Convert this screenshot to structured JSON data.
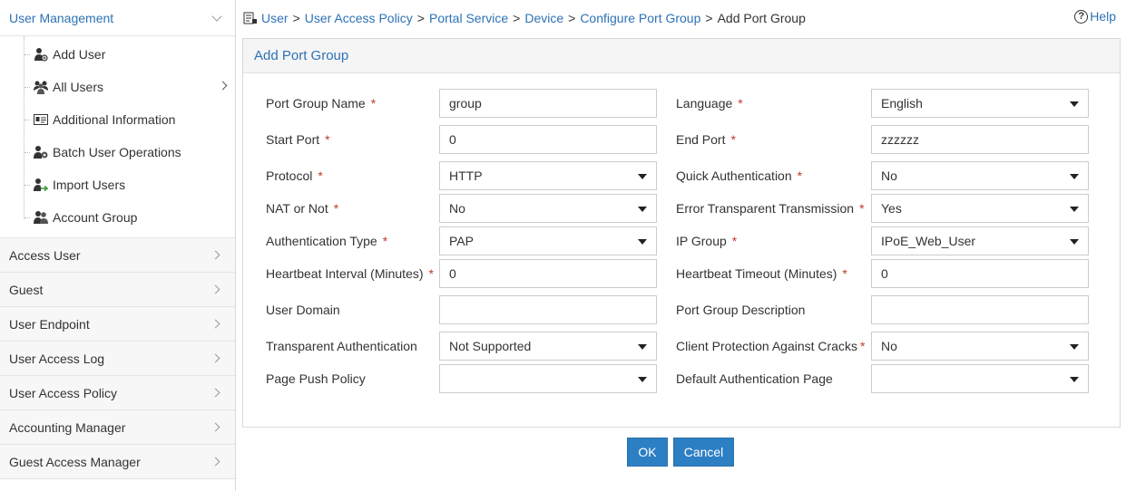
{
  "sidebar": {
    "header": "User Management",
    "sub_items": [
      {
        "label": "Add User",
        "icon": "add-user-icon"
      },
      {
        "label": "All Users",
        "icon": "all-users-icon"
      },
      {
        "label": "Additional Information",
        "icon": "id-card-icon"
      },
      {
        "label": "Batch User Operations",
        "icon": "batch-users-icon"
      },
      {
        "label": "Import Users",
        "icon": "import-users-icon"
      },
      {
        "label": "Account Group",
        "icon": "account-group-icon"
      }
    ],
    "categories": [
      "Access User",
      "Guest",
      "User Endpoint",
      "User Access Log",
      "User Access Policy",
      "Accounting Manager",
      "Guest Access Manager"
    ]
  },
  "breadcrumb": [
    "User",
    "User Access Policy",
    "Portal Service",
    "Device",
    "Configure Port Group",
    "Add Port Group"
  ],
  "breadcrumb_sep": ">",
  "help_label": "Help",
  "panel_title": "Add Port Group",
  "required_mark": "*",
  "form": {
    "port_group_name": {
      "label": "Port Group Name",
      "value": "group"
    },
    "language": {
      "label": "Language",
      "value": "English"
    },
    "start_port": {
      "label": "Start Port",
      "value": "0"
    },
    "end_port": {
      "label": "End Port",
      "value": "zzzzzz"
    },
    "protocol": {
      "label": "Protocol",
      "value": "HTTP"
    },
    "quick_auth": {
      "label": "Quick Authentication",
      "value": "No"
    },
    "nat": {
      "label": "NAT or Not",
      "value": "No"
    },
    "error_transparent": {
      "label": "Error Transparent Transmission",
      "value": "Yes"
    },
    "auth_type": {
      "label": "Authentication Type",
      "value": "PAP"
    },
    "ip_group": {
      "label": "IP Group",
      "value": "IPoE_Web_User"
    },
    "heartbeat_interval": {
      "label": "Heartbeat Interval (Minutes)",
      "value": "0"
    },
    "heartbeat_timeout": {
      "label": "Heartbeat Timeout (Minutes)",
      "value": "0"
    },
    "user_domain": {
      "label": "User Domain",
      "value": ""
    },
    "description": {
      "label": "Port Group Description",
      "value": ""
    },
    "transparent_auth": {
      "label": "Transparent Authentication",
      "value": "Not Supported"
    },
    "client_protection": {
      "label": "Client Protection Against Cracks",
      "value": "No"
    },
    "page_push_policy": {
      "label": "Page Push Policy",
      "value": ""
    },
    "default_auth_page": {
      "label": "Default Authentication Page",
      "value": ""
    }
  },
  "buttons": {
    "ok": "OK",
    "cancel": "Cancel"
  },
  "colors": {
    "accent": "#2d72b5",
    "button": "#2d7fc4",
    "required": "#c0392b"
  }
}
